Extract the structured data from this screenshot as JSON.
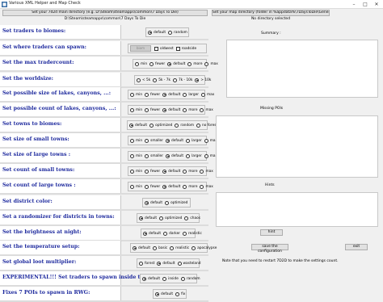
{
  "window": {
    "title": "Various XML Helper and Map Check",
    "minimize": "–",
    "maximize": "□",
    "close": "✕"
  },
  "top": {
    "path_button": "Set your 7d2d main directory (e.g. D:\\Steam\\steamapps\\common\\7 Days To Die)",
    "path_value": "D:\\Steam\\steamapps\\common\\7 Days To Die",
    "map_button": "Set your map directory (folder in %appdata%\\7DaysToDie\\GeneratedWorlds)",
    "map_value": "No directory selected"
  },
  "settings": [
    {
      "label": "Set traders to biomes:",
      "options": [
        {
          "text": "default",
          "selected": true
        },
        {
          "text": "random",
          "selected": false
        }
      ]
    },
    {
      "label": "Set where traders can spawn:",
      "button": "biom",
      "checkboxes": [
        "oldwest",
        "roadside"
      ]
    },
    {
      "label": "Set the max tradercount:",
      "options": [
        {
          "text": "min",
          "selected": false
        },
        {
          "text": "fewer",
          "selected": false
        },
        {
          "text": "default",
          "selected": true
        },
        {
          "text": "more",
          "selected": false
        },
        {
          "text": "max",
          "selected": false
        }
      ]
    },
    {
      "label": "Set the worldsize:",
      "options": [
        {
          "text": "< 5k",
          "selected": false
        },
        {
          "text": "5k - 7k",
          "selected": false
        },
        {
          "text": "7k - 10k",
          "selected": false
        },
        {
          "text": "> 10k",
          "selected": true
        }
      ]
    },
    {
      "label": "Set possible size of lakes, canyons, ...:",
      "options": [
        {
          "text": "min",
          "selected": false
        },
        {
          "text": "fewer",
          "selected": false
        },
        {
          "text": "default",
          "selected": true
        },
        {
          "text": "larger",
          "selected": false
        },
        {
          "text": "max",
          "selected": false
        }
      ]
    },
    {
      "label": "Set possible count of lakes, canyons, ...:",
      "options": [
        {
          "text": "min",
          "selected": false
        },
        {
          "text": "fewer",
          "selected": false
        },
        {
          "text": "default",
          "selected": true
        },
        {
          "text": "more",
          "selected": false
        },
        {
          "text": "max",
          "selected": false
        }
      ]
    },
    {
      "label": "Set towns to biomes:",
      "options": [
        {
          "text": "default",
          "selected": true
        },
        {
          "text": "optimized",
          "selected": false
        },
        {
          "text": "random",
          "selected": false
        },
        {
          "text": "no forest",
          "selected": false
        }
      ]
    },
    {
      "label": "Set size of small towns:",
      "options": [
        {
          "text": "min",
          "selected": false
        },
        {
          "text": "smaller",
          "selected": false
        },
        {
          "text": "default",
          "selected": true
        },
        {
          "text": "larger",
          "selected": false
        },
        {
          "text": "max",
          "selected": false
        }
      ]
    },
    {
      "label": "Set size of large towns :",
      "options": [
        {
          "text": "min",
          "selected": false
        },
        {
          "text": "smaller",
          "selected": false
        },
        {
          "text": "default",
          "selected": true
        },
        {
          "text": "larger",
          "selected": false
        },
        {
          "text": "max",
          "selected": false
        }
      ]
    },
    {
      "label": "Set count of small towns:",
      "options": [
        {
          "text": "min",
          "selected": false
        },
        {
          "text": "fewer",
          "selected": false
        },
        {
          "text": "default",
          "selected": true
        },
        {
          "text": "more",
          "selected": false
        },
        {
          "text": "max",
          "selected": false
        }
      ]
    },
    {
      "label": "Set count of large towns :",
      "options": [
        {
          "text": "min",
          "selected": false
        },
        {
          "text": "fewer",
          "selected": false
        },
        {
          "text": "default",
          "selected": true
        },
        {
          "text": "more",
          "selected": false
        },
        {
          "text": "max",
          "selected": false
        }
      ]
    },
    {
      "label": "Set district color:",
      "options": [
        {
          "text": "default",
          "selected": true
        },
        {
          "text": "optimized",
          "selected": false
        }
      ]
    },
    {
      "label": "Set a randomizer for districts in towns:",
      "options": [
        {
          "text": "default",
          "selected": true
        },
        {
          "text": "optimized",
          "selected": false
        },
        {
          "text": "chaos",
          "selected": false
        }
      ]
    },
    {
      "label": "Set the brightness at night:",
      "options": [
        {
          "text": "default",
          "selected": true
        },
        {
          "text": "darker",
          "selected": false
        },
        {
          "text": "realistic",
          "selected": false
        }
      ]
    },
    {
      "label": "Set the temperature setup:",
      "options": [
        {
          "text": "default",
          "selected": true
        },
        {
          "text": "basic",
          "selected": false
        },
        {
          "text": "realistic",
          "selected": false
        },
        {
          "text": "apocalypse",
          "selected": false
        }
      ]
    },
    {
      "label": "Set global loot multiplier:",
      "options": [
        {
          "text": "forest",
          "selected": false
        },
        {
          "text": "default",
          "selected": true
        },
        {
          "text": "wasteland",
          "selected": false
        }
      ]
    },
    {
      "label": "EXPERIMENTAL!!! Set traders to spawn inside towns:",
      "options": [
        {
          "text": "default",
          "selected": true
        },
        {
          "text": "inside",
          "selected": false
        },
        {
          "text": "random",
          "selected": false
        }
      ]
    },
    {
      "label": "Fixes 7 POIs to spawn in RWG:",
      "options": [
        {
          "text": "default",
          "selected": true
        },
        {
          "text": "fix",
          "selected": false
        }
      ]
    }
  ],
  "right": {
    "summary_label": "Summary :",
    "missing_label": "Missing POIs",
    "hints_label": "Hints",
    "hint_button": "hint",
    "save_button": "save the configuration",
    "exit_button": "exit",
    "note": "Note that you need to restart 7D2D to make the settings count."
  },
  "colors": {
    "label_text": "#1e2a9e"
  }
}
